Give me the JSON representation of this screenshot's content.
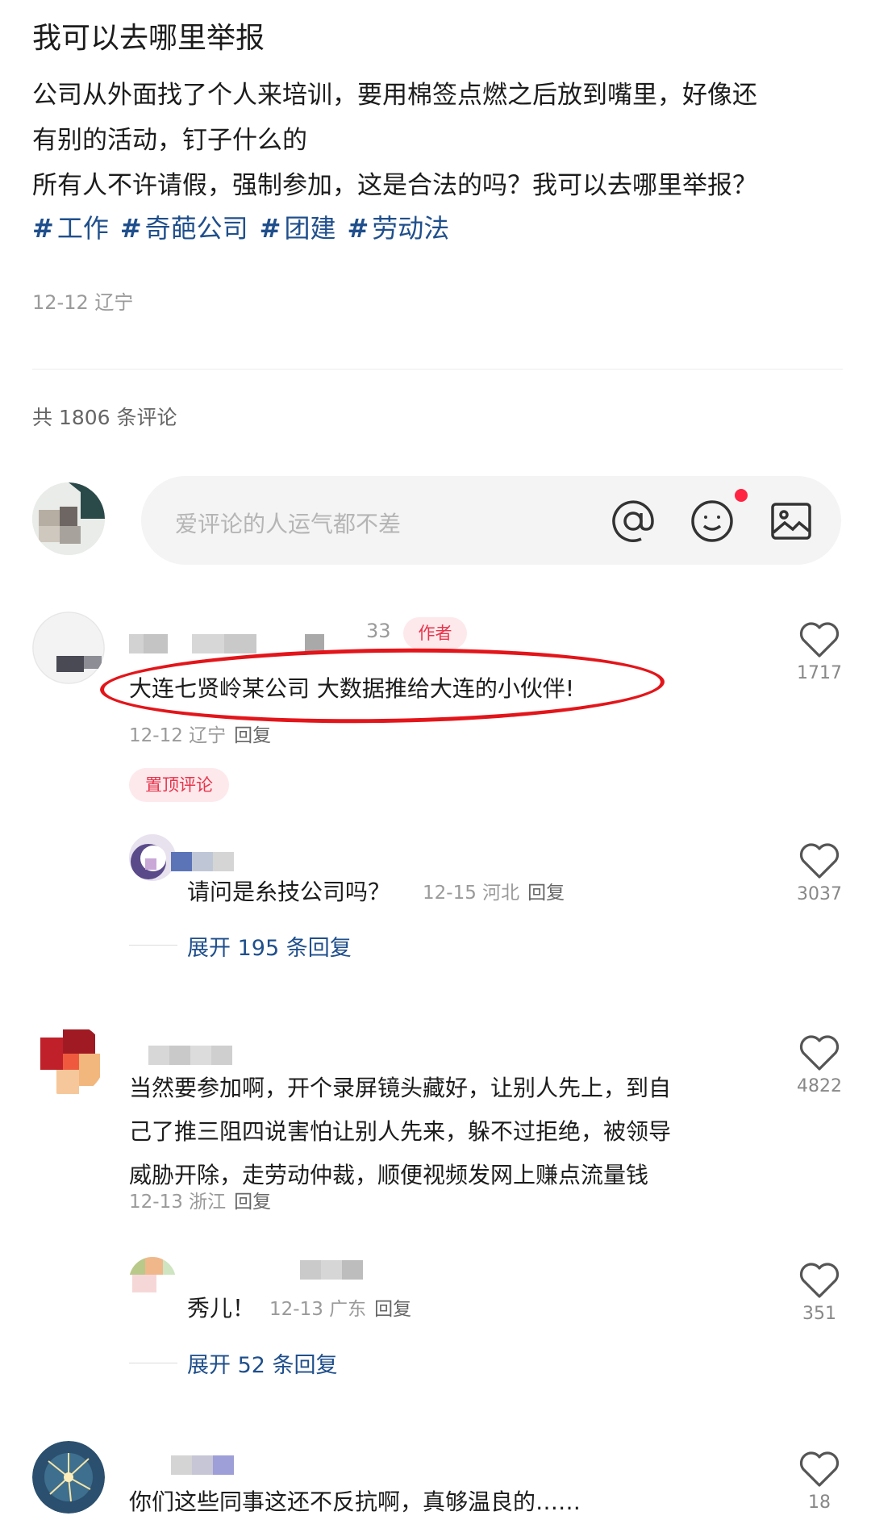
{
  "post": {
    "title": "我可以去哪里举报",
    "body_lines": [
      "公司从外面找了个人来培训，要用棉签点燃之后放到嘴里，好像还",
      "有别的活动，钉子什么的",
      "所有人不许请假，强制参加，这是合法的吗？我可以去哪里举报？"
    ],
    "tags": [
      "工作",
      "奇葩公司",
      "团建",
      "劳动法"
    ],
    "meta": "12-12 辽宁"
  },
  "comments_header": {
    "count_label": "共 1806 条评论"
  },
  "input": {
    "placeholder": "爱评论的人运气都不差",
    "icons": [
      "at-icon",
      "emoji-icon",
      "image-icon"
    ],
    "notification_dot_color": "#ff2442"
  },
  "comments": [
    {
      "name_suffix": "33",
      "badge": "作者",
      "text": "大连七贤岭某公司 大数据推给大连的小伙伴!",
      "meta": "12-12 辽宁",
      "reply_label": "回复",
      "likes": "1717",
      "pin_label": "置顶评论",
      "reply": {
        "text": "请问是糸技公司吗？",
        "meta": "12-15 河北",
        "reply_label": "回复",
        "likes": "3037"
      },
      "expand_label": "展开 195 条回复"
    },
    {
      "lines": [
        "当然要参加啊，开个录屏镜头藏好，让别人先上，到自",
        "己了推三阻四说害怕让别人先来，躲不过拒绝，被领导",
        "威胁开除，走劳动仲裁，顺便视频发网上赚点流量钱"
      ],
      "meta": "12-13 浙江",
      "reply_label": "回复",
      "likes": "4822",
      "reply": {
        "text": "秀儿！",
        "meta": "12-13 广东",
        "reply_label": "回复",
        "likes": "351"
      },
      "expand_label": "展开 52 条回复"
    },
    {
      "text": "你们这些同事这还不反抗啊，真够温良的……",
      "likes": "18"
    }
  ],
  "colors": {
    "tag_blue": "#1f4f8c",
    "accent_red": "#e8334a",
    "highlight_ellipse": "#e3151a"
  }
}
